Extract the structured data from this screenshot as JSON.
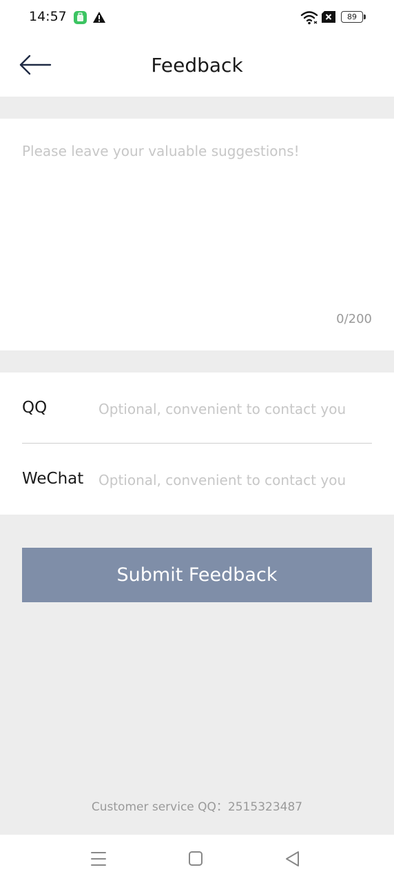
{
  "status_bar": {
    "time": "14:57",
    "battery_level": "89",
    "icons": [
      "app-notification-icon",
      "warning-icon",
      "wifi-icon",
      "no-sim-icon",
      "battery-icon"
    ]
  },
  "header": {
    "back_icon": "arrow-left-icon",
    "title": "Feedback"
  },
  "feedback": {
    "placeholder": "Please leave your valuable suggestions!",
    "value": "",
    "counter": "0/200"
  },
  "contact": {
    "qq_label": "QQ",
    "qq_placeholder": "Optional, convenient to contact you",
    "wechat_label": "WeChat",
    "wechat_placeholder": "Optional, convenient to contact you"
  },
  "submit_label": "Submit Feedback",
  "footer": {
    "service_text": "Customer service QQ：2515323487"
  },
  "nav_bar": {
    "icons": [
      "menu-icon",
      "home-square-icon",
      "back-triangle-icon"
    ]
  },
  "colors": {
    "background": "#ededed",
    "card": "#ffffff",
    "submit_button": "#7f8ea8",
    "placeholder": "#c7c7c7",
    "muted_text": "#9a9a9a"
  }
}
